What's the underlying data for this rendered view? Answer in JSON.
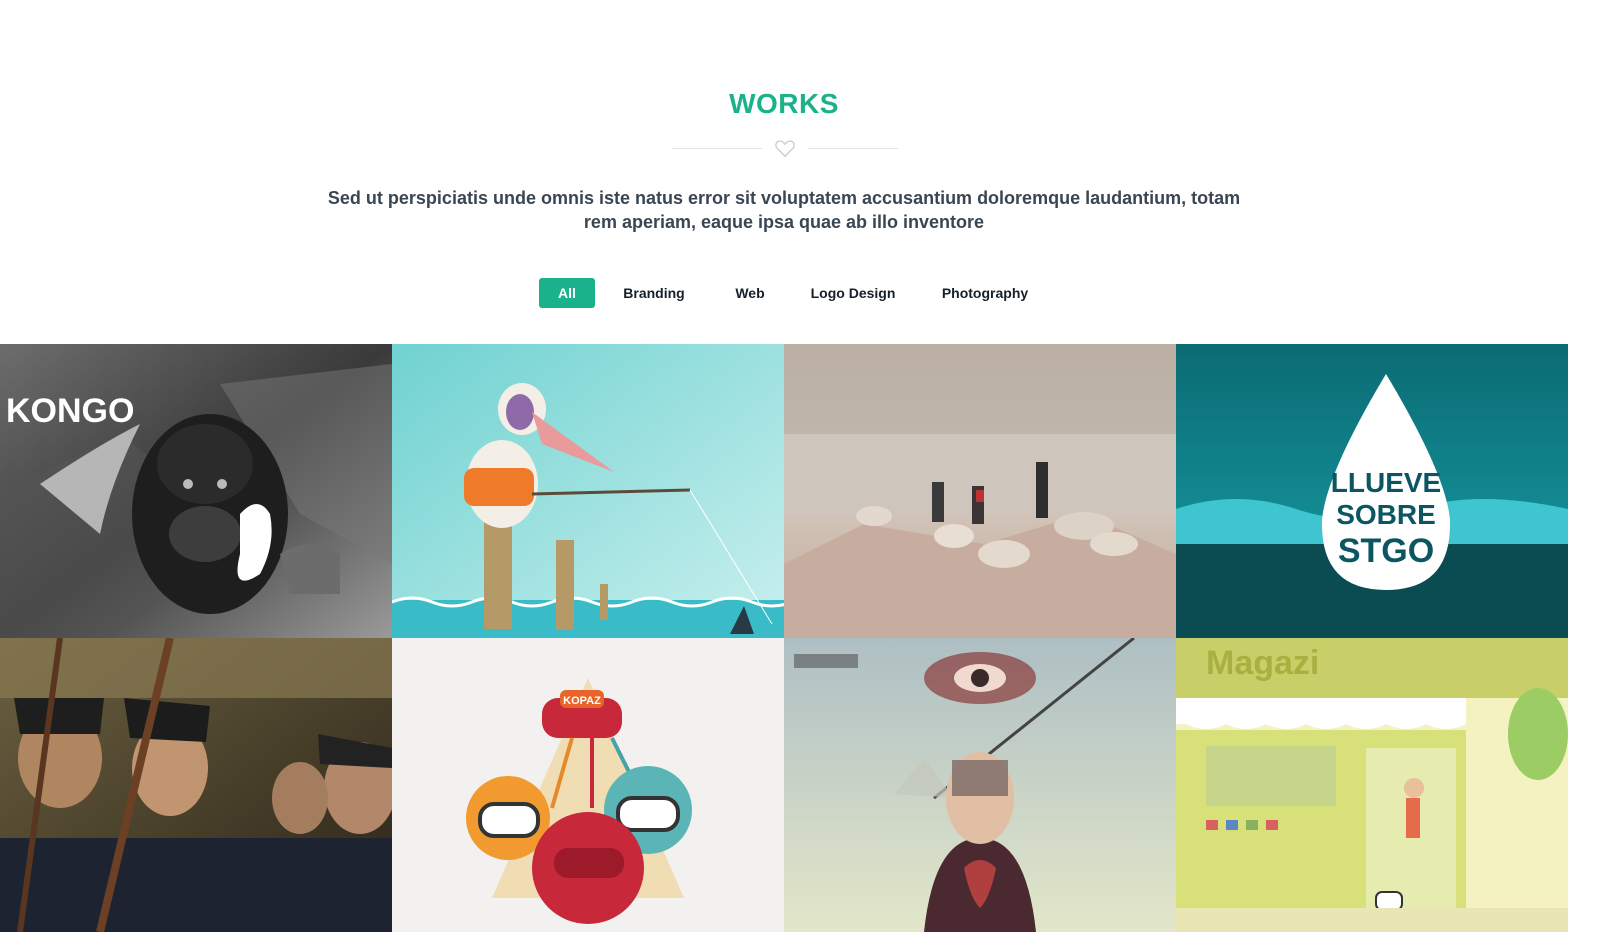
{
  "section": {
    "title": "WORKS",
    "lead": "Sed ut perspiciatis unde omnis iste natus error sit voluptatem accusantium doloremque laudantium, totam rem aperiam, eaque ipsa quae ab illo inventore",
    "divider_icon": "heart-outline-icon"
  },
  "filters": [
    {
      "label": "All",
      "active": true
    },
    {
      "label": "Branding",
      "active": false
    },
    {
      "label": "Web",
      "active": false
    },
    {
      "label": "Logo Design",
      "active": false
    },
    {
      "label": "Photography",
      "active": false
    }
  ],
  "portfolio": {
    "items": [
      {
        "image": "kong-collage-image",
        "text": "KONGO"
      },
      {
        "image": "pelican-fishing-illustration"
      },
      {
        "image": "hikers-misty-lake-photo"
      },
      {
        "image": "llueve-sobre-stgo-logo",
        "lines": [
          "LLUEVE",
          "SOBRE",
          "STGO"
        ]
      },
      {
        "image": "civil-war-soldiers-photo"
      },
      {
        "image": "kopaz-monsters-tshirt",
        "text": "KOPAZ"
      },
      {
        "image": "surreal-eye-portrait-collage"
      },
      {
        "image": "magazine-shop-illustration",
        "text": "Magazi"
      }
    ]
  },
  "colors": {
    "accent": "#19b28b",
    "text_dark": "#16202b",
    "lead_text": "#3b4653"
  }
}
